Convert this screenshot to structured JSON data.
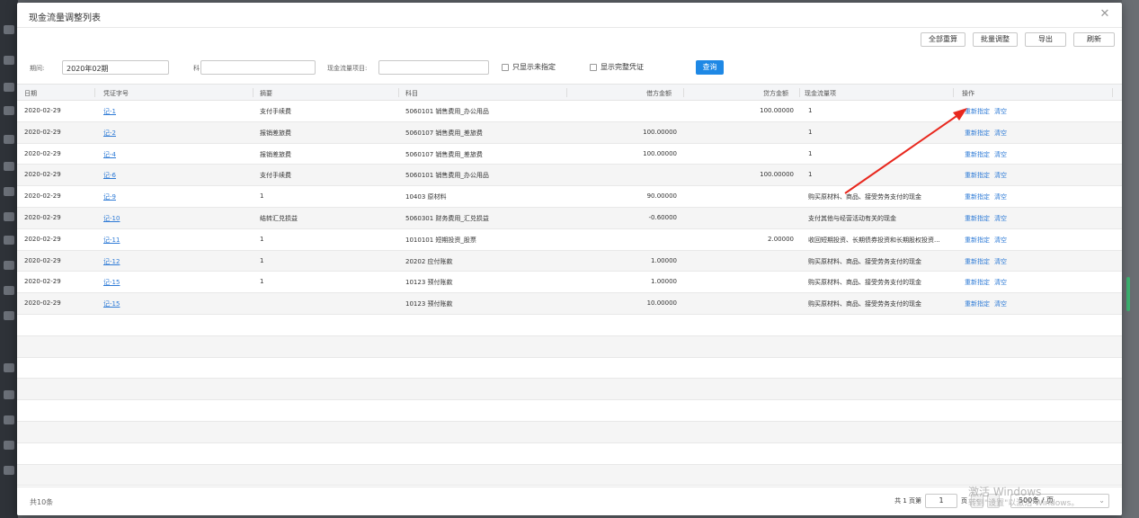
{
  "modal": {
    "title": "现金流量调整列表",
    "close": "✕"
  },
  "toolbar": {
    "recalc_all": "全部重算",
    "batch_adjust": "批量调整",
    "export": "导出",
    "refresh": "刷新"
  },
  "filters": {
    "period_label": "期间:",
    "period_value": "2020年02期",
    "subject_label": "科目:",
    "subject_value": "",
    "cashflow_label": "现金流量项目:",
    "cashflow_value": "",
    "only_unassigned": "只显示未指定",
    "show_full_voucher": "显示完整凭证",
    "query": "查询"
  },
  "table": {
    "headers": [
      "日期",
      "凭证字号",
      "摘要",
      "科目",
      "借方金额",
      "贷方金额",
      "现金流量项",
      "操作"
    ],
    "rows": [
      {
        "date": "2020-02-29",
        "voucher": "记-1",
        "summary": "支付手续费",
        "subject": "5060101 销售费用_办公用品",
        "debit": "",
        "credit": "100.00000",
        "cashflow": "1",
        "op1": "重新指定",
        "op2": "清空"
      },
      {
        "date": "2020-02-29",
        "voucher": "记-2",
        "summary": "报销差旅费",
        "subject": "5060107 销售费用_差旅费",
        "debit": "100.00000",
        "credit": "",
        "cashflow": "1",
        "op1": "重新指定",
        "op2": "清空"
      },
      {
        "date": "2020-02-29",
        "voucher": "记-4",
        "summary": "报销差旅费",
        "subject": "5060107 销售费用_差旅费",
        "debit": "100.00000",
        "credit": "",
        "cashflow": "1",
        "op1": "重新指定",
        "op2": "清空"
      },
      {
        "date": "2020-02-29",
        "voucher": "记-6",
        "summary": "支付手续费",
        "subject": "5060101 销售费用_办公用品",
        "debit": "",
        "credit": "100.00000",
        "cashflow": "1",
        "op1": "重新指定",
        "op2": "清空"
      },
      {
        "date": "2020-02-29",
        "voucher": "记-9",
        "summary": "1",
        "subject": "10403 原材料",
        "debit": "90.00000",
        "credit": "",
        "cashflow": "购买原材料、商品、接受劳务支付的现金",
        "op1": "重新指定",
        "op2": "清空"
      },
      {
        "date": "2020-02-29",
        "voucher": "记-10",
        "summary": "结转汇兑损益",
        "subject": "5060301 财务费用_汇兑损益",
        "debit": "-0.60000",
        "credit": "",
        "cashflow": "支付其他与经营活动有关的现金",
        "op1": "重新指定",
        "op2": "清空"
      },
      {
        "date": "2020-02-29",
        "voucher": "记-11",
        "summary": "1",
        "subject": "1010101 短期投资_股票",
        "debit": "",
        "credit": "2.00000",
        "cashflow": "收回短期投资、长期债券投资和长期股权投资...",
        "op1": "重新指定",
        "op2": "清空"
      },
      {
        "date": "2020-02-29",
        "voucher": "记-12",
        "summary": "1",
        "subject": "20202 应付账款",
        "debit": "1.00000",
        "credit": "",
        "cashflow": "购买原材料、商品、接受劳务支付的现金",
        "op1": "重新指定",
        "op2": "清空"
      },
      {
        "date": "2020-02-29",
        "voucher": "记-15",
        "summary": "1",
        "subject": "10123 预付账款",
        "debit": "1.00000",
        "credit": "",
        "cashflow": "购买原材料、商品、接受劳务支付的现金",
        "op1": "重新指定",
        "op2": "清空"
      },
      {
        "date": "2020-02-29",
        "voucher": "记-15",
        "summary": "",
        "subject": "10123 预付账款",
        "debit": "10.00000",
        "credit": "",
        "cashflow": "购买原材料、商品、接受劳务支付的现金",
        "op1": "重新指定",
        "op2": "清空"
      }
    ]
  },
  "footer": {
    "total": "共10条",
    "pages_prefix": "共 1 页第",
    "page_value": "1",
    "page_suffix": "页",
    "page_size": "500条 / 页"
  },
  "watermark": {
    "line1": "激活 Windows",
    "line2": "转到\"设置\"以激活 Windows。"
  },
  "colors": {
    "link": "#2d7ad6",
    "primary_button": "#1e88e5",
    "annotation_arrow": "#e8281e"
  }
}
